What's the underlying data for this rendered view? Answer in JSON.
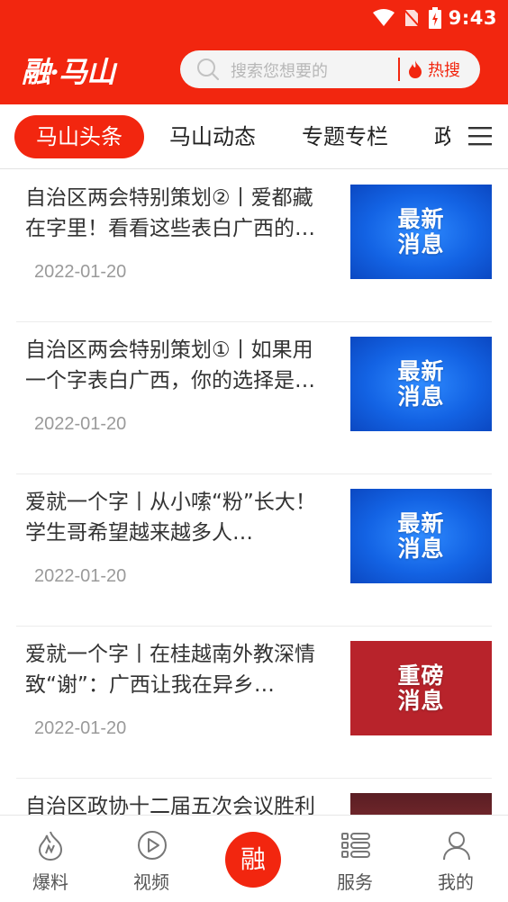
{
  "status_bar": {
    "time": "9:43"
  },
  "header": {
    "logo_text": "融·马山",
    "search_placeholder": "搜索您想要的",
    "hot_search_label": "热搜"
  },
  "tabs": [
    {
      "label": "马山头条",
      "active": true
    },
    {
      "label": "马山动态",
      "active": false
    },
    {
      "label": "专题专栏",
      "active": false
    },
    {
      "label": "政",
      "active": false
    }
  ],
  "news": [
    {
      "title": "自治区两会特别策划②丨爱都藏在字里！看看这些表白广西的…",
      "date": "2022-01-20",
      "thumb": "最新消息",
      "thumb_style": "blue"
    },
    {
      "title": "自治区两会特别策划①丨如果用一个字表白广西，你的选择是…",
      "date": "2022-01-20",
      "thumb": "最新消息",
      "thumb_style": "blue"
    },
    {
      "title": "爱就一个字丨从小嗦“粉”长大！学生哥希望越来越多人…",
      "date": "2022-01-20",
      "thumb": "最新消息",
      "thumb_style": "blue"
    },
    {
      "title": "爱就一个字丨在桂越南外教深情致“谢”：广西让我在异乡…",
      "date": "2022-01-20",
      "thumb": "重磅消息",
      "thumb_style": "red"
    },
    {
      "title": "自治区政协十二届五次会议胜利闭幕",
      "date": "",
      "thumb": "",
      "thumb_style": "photo"
    }
  ],
  "bottom_nav": {
    "items": [
      {
        "label": "爆料",
        "icon": "fire-icon"
      },
      {
        "label": "视频",
        "icon": "play-icon"
      },
      {
        "label": "融",
        "icon": "center"
      },
      {
        "label": "服务",
        "icon": "list-icon"
      },
      {
        "label": "我的",
        "icon": "user-icon"
      }
    ]
  },
  "colors": {
    "brand": "#f2260f",
    "thumb_blue": "#1363e4",
    "thumb_red": "#b8232b"
  }
}
